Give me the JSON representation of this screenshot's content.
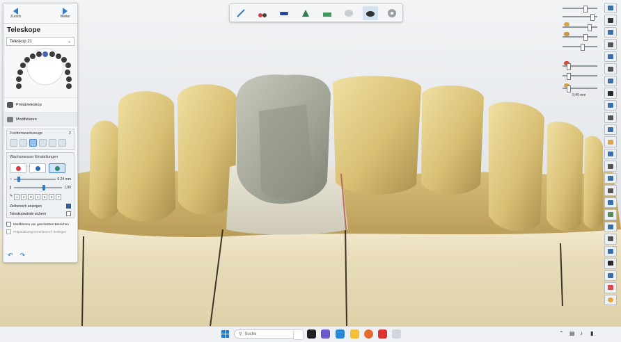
{
  "nav": {
    "back_label": "Zurück",
    "next_label": "Weiter"
  },
  "panel": {
    "title": "Teleskope",
    "select_value": "Teleskop 21",
    "list_items": [
      "Primärteleskop",
      "Modifizieren"
    ],
    "freeform": {
      "title": "Freiformwerkzeuge",
      "count": "2"
    },
    "knife": {
      "title": "Wachsmesser Einstellungen"
    },
    "slider1_value": "0,24 mm",
    "slider2_value": "1,00",
    "numbers": [
      "1",
      "2",
      "3",
      "4",
      "5",
      "6",
      "7"
    ],
    "check1_label": "Zielbereich anzeigen",
    "check2_label": "Teleskopwände sichern",
    "check3_label": "Modifizieren von geschützten Bereichen",
    "check4_label": "Präparationsgrenzenbereich festlegen"
  },
  "right": {
    "distance_value": "0,40 mm"
  },
  "taskbar": {
    "search_placeholder": "Suche"
  },
  "colors": {
    "accent": "#2f7dd0",
    "tooth": "#d9c27a",
    "crown": "#a7aa9c"
  }
}
